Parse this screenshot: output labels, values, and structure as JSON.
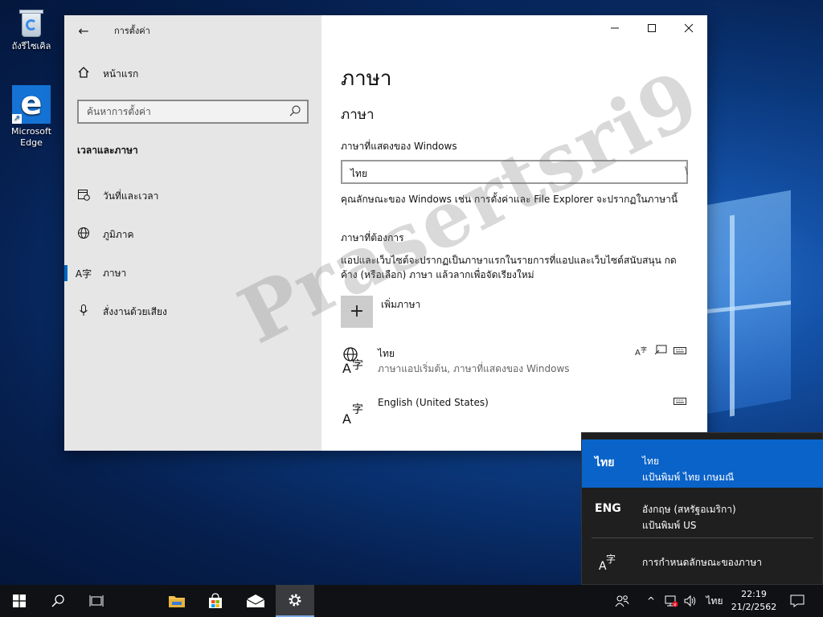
{
  "desktop": {
    "recycle_bin_label": "ถังรีไซเคิล",
    "edge_label_line1": "Microsoft",
    "edge_label_line2": "Edge"
  },
  "window": {
    "title": "การตั้งค่า",
    "caption": {
      "minimize": "—",
      "maximize": "☐",
      "close": "✕"
    }
  },
  "sidebar": {
    "home_label": "หน้าแรก",
    "search_placeholder": "ค้นหาการตั้งค่า",
    "section_label": "เวลาและภาษา",
    "items": [
      {
        "label": "วันที่และเวลา",
        "icon": "calendar-clock-icon"
      },
      {
        "label": "ภูมิภาค",
        "icon": "globe-icon"
      },
      {
        "label": "ภาษา",
        "icon": "language-icon",
        "selected": true
      },
      {
        "label": "สั่งงานด้วยเสียง",
        "icon": "microphone-icon"
      }
    ]
  },
  "main": {
    "page_title": "ภาษา",
    "sub_title": "ภาษา",
    "display_language_label": "ภาษาที่แสดงของ Windows",
    "display_language_value": "ไทย",
    "display_language_desc": "คุณลักษณะของ Windows เช่น การตั้งค่าและ File Explorer จะปรากฏในภาษานี้",
    "preferred_label": "ภาษาที่ต้องการ",
    "preferred_desc": "แอปและเว็บไซต์จะปรากฏเป็นภาษาแรกในรายการที่แอปและเว็บไซต์สนับสนุน กดค้าง (หรือเลือก) ภาษา แล้วลากเพื่อจัดเรียงใหม่",
    "add_language_label": "เพิ่มภาษา",
    "languages": [
      {
        "name": "ไทย",
        "sub": "ภาษาแอปเริ่มต้น, ภาษาที่แสดงของ Windows"
      },
      {
        "name": "English (United States)",
        "sub": ""
      }
    ]
  },
  "flyout": {
    "items": [
      {
        "abbr": "ไทย",
        "line1": "ไทย",
        "line2": "แป้นพิมพ์ ไทย เกษมณี",
        "selected": true
      },
      {
        "abbr": "ENG",
        "line1": "อังกฤษ (สหรัฐอเมริกา)",
        "line2": "แป้นพิมพ์ US",
        "selected": false
      }
    ],
    "preferences_label": "การกำหนดลักษณะของภาษา"
  },
  "taskbar": {
    "apps": [
      "start",
      "search",
      "task-view",
      "file-explorer",
      "store",
      "mail",
      "settings"
    ],
    "active_app": "settings",
    "input_indicator": "ไทย",
    "time": "22:19",
    "date": "21/2/2562"
  },
  "watermark": "Prasertsri9",
  "colors": {
    "accent": "#0067c0",
    "flyout_selected": "#0a63c9",
    "sidebar_bg": "#e6e6e6",
    "taskbar_bg": "#101114"
  }
}
